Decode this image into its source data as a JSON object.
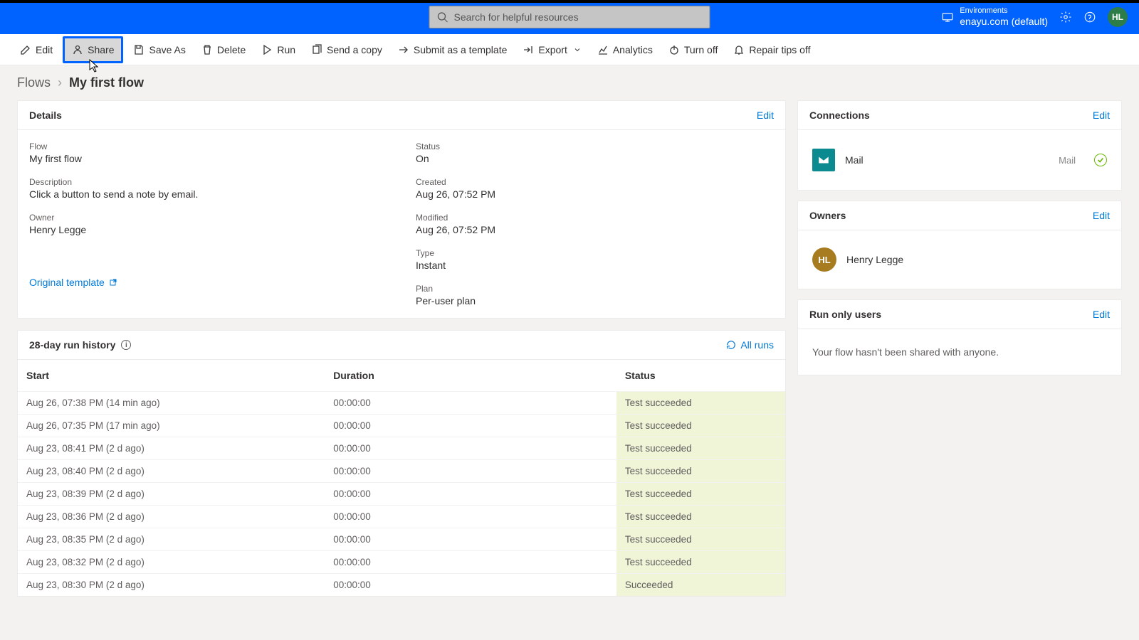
{
  "header": {
    "search_placeholder": "Search for helpful resources",
    "env_label": "Environments",
    "env_value": "enayu.com (default)",
    "avatar_initials": "HL"
  },
  "commands": {
    "edit": "Edit",
    "share": "Share",
    "save_as": "Save As",
    "delete": "Delete",
    "run": "Run",
    "send_copy": "Send a copy",
    "submit_template": "Submit as a template",
    "export": "Export",
    "analytics": "Analytics",
    "turn_off": "Turn off",
    "repair_tips": "Repair tips off"
  },
  "breadcrumb": {
    "root": "Flows",
    "current": "My first flow"
  },
  "details": {
    "title": "Details",
    "edit": "Edit",
    "flow_label": "Flow",
    "flow_value": "My first flow",
    "description_label": "Description",
    "description_value": "Click a button to send a note by email.",
    "owner_label": "Owner",
    "owner_value": "Henry Legge",
    "status_label": "Status",
    "status_value": "On",
    "created_label": "Created",
    "created_value": "Aug 26, 07:52 PM",
    "modified_label": "Modified",
    "modified_value": "Aug 26, 07:52 PM",
    "type_label": "Type",
    "type_value": "Instant",
    "plan_label": "Plan",
    "plan_value": "Per-user plan",
    "template_link": "Original template"
  },
  "history": {
    "title": "28-day run history",
    "all_runs": "All runs",
    "col_start": "Start",
    "col_duration": "Duration",
    "col_status": "Status",
    "rows": [
      {
        "start": "Aug 26, 07:38 PM (14 min ago)",
        "duration": "00:00:00",
        "status": "Test succeeded"
      },
      {
        "start": "Aug 26, 07:35 PM (17 min ago)",
        "duration": "00:00:00",
        "status": "Test succeeded"
      },
      {
        "start": "Aug 23, 08:41 PM (2 d ago)",
        "duration": "00:00:00",
        "status": "Test succeeded"
      },
      {
        "start": "Aug 23, 08:40 PM (2 d ago)",
        "duration": "00:00:00",
        "status": "Test succeeded"
      },
      {
        "start": "Aug 23, 08:39 PM (2 d ago)",
        "duration": "00:00:00",
        "status": "Test succeeded"
      },
      {
        "start": "Aug 23, 08:36 PM (2 d ago)",
        "duration": "00:00:00",
        "status": "Test succeeded"
      },
      {
        "start": "Aug 23, 08:35 PM (2 d ago)",
        "duration": "00:00:00",
        "status": "Test succeeded"
      },
      {
        "start": "Aug 23, 08:32 PM (2 d ago)",
        "duration": "00:00:00",
        "status": "Test succeeded"
      },
      {
        "start": "Aug 23, 08:30 PM (2 d ago)",
        "duration": "00:00:00",
        "status": "Succeeded"
      }
    ]
  },
  "connections": {
    "title": "Connections",
    "edit": "Edit",
    "items": [
      {
        "name": "Mail",
        "type": "Mail"
      }
    ]
  },
  "owners": {
    "title": "Owners",
    "edit": "Edit",
    "items": [
      {
        "initials": "HL",
        "name": "Henry Legge"
      }
    ]
  },
  "run_only": {
    "title": "Run only users",
    "edit": "Edit",
    "empty": "Your flow hasn't been shared with anyone."
  }
}
